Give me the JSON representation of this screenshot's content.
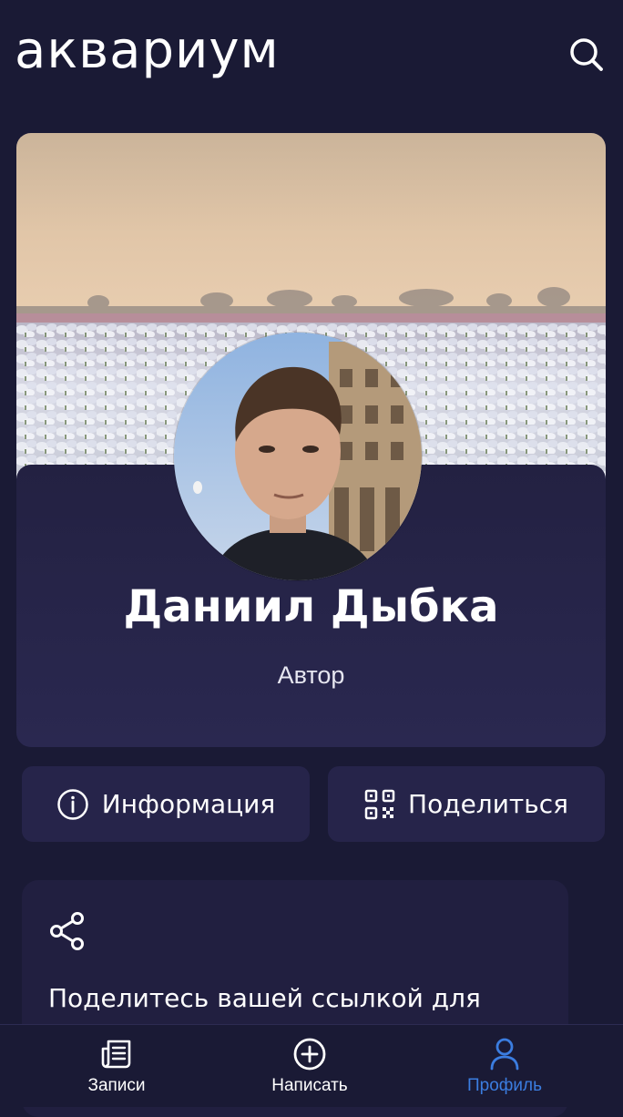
{
  "app": {
    "logo": "аквариум"
  },
  "header": {
    "search_icon": "search-icon"
  },
  "profile": {
    "name": "Даниил Дыбка",
    "role": "Автор"
  },
  "actions": {
    "info_label": "Информация",
    "info_icon": "info-circle-icon",
    "share_label": "Поделиться",
    "share_icon": "qr-code-icon"
  },
  "share_card": {
    "icon": "share-nodes-icon",
    "text": "Поделитесь вашей ссылкой для"
  },
  "bottom_nav": {
    "items": [
      {
        "label": "Записи",
        "icon": "newspaper-icon",
        "active": false
      },
      {
        "label": "Написать",
        "icon": "plus-circle-icon",
        "active": false
      },
      {
        "label": "Профиль",
        "icon": "user-icon",
        "active": true
      }
    ]
  },
  "colors": {
    "background": "#1a1a35",
    "card": "#26244a",
    "accent": "#3b7de0"
  }
}
